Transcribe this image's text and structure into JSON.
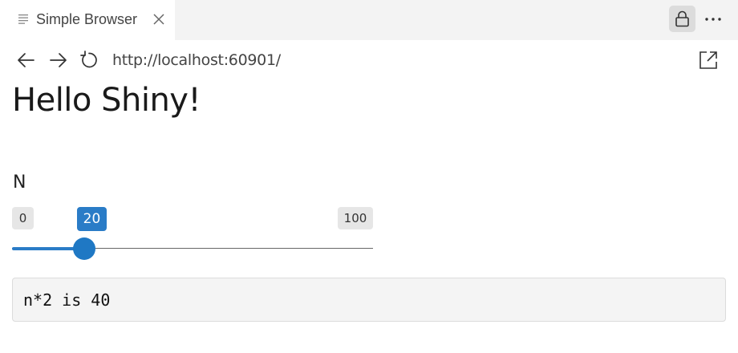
{
  "tab": {
    "label": "Simple Browser",
    "icon": "document-lines-icon",
    "close_icon": "close-icon"
  },
  "toolbar": {
    "lock_icon": "lock-icon",
    "more_icon": "ellipsis-icon"
  },
  "nav": {
    "back_icon": "arrow-left-icon",
    "forward_icon": "arrow-right-icon",
    "reload_icon": "reload-icon",
    "url": "http://localhost:60901/",
    "open_external_icon": "open-external-icon"
  },
  "page": {
    "title": "Hello Shiny!",
    "slider": {
      "label": "N",
      "min": "0",
      "max": "100",
      "value": "20",
      "fraction": 0.2,
      "accent": "#2a7cc7"
    },
    "output": "n*2 is 40"
  }
}
